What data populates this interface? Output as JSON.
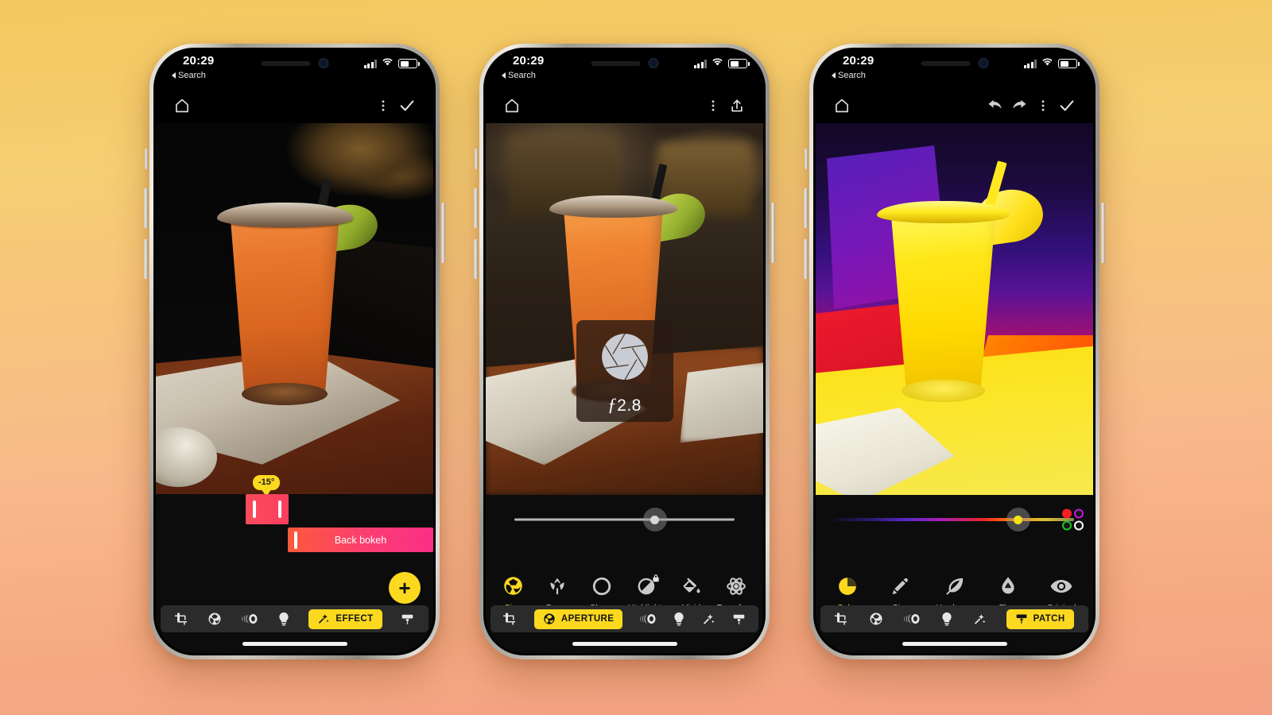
{
  "background": {
    "top_color": "#f3c85f",
    "bottom_color": "#f3a184"
  },
  "accent": {
    "yellow": "#fcd91f",
    "red_slider": "#fb4a5c",
    "pink_slider": "#fa2f86"
  },
  "status_bar": {
    "time": "20:29",
    "back_label": "Search"
  },
  "phones": [
    {
      "id": "phone-one",
      "appbar": {
        "home_icon": "home-icon",
        "menu_icon": "overflow-menu-icon",
        "confirm_icon": "checkmark-icon"
      },
      "overlay": {
        "angle_tooltip": "-15°",
        "effect_slider_label": "Back bokeh"
      },
      "fab_label": "+",
      "bottom_nav": {
        "items": [
          {
            "name": "crop",
            "icon": "crop-icon",
            "label": ""
          },
          {
            "name": "aperture",
            "icon": "aperture-icon",
            "label": ""
          },
          {
            "name": "lens",
            "icon": "lens-icon",
            "label": ""
          },
          {
            "name": "light",
            "icon": "bulb-icon",
            "label": ""
          },
          {
            "name": "effect",
            "icon": "magic-wand-icon",
            "label": "EFFECT",
            "active": true
          },
          {
            "name": "patch",
            "icon": "brush-icon",
            "label": ""
          }
        ]
      }
    },
    {
      "id": "phone-two",
      "appbar": {
        "home_icon": "home-icon",
        "menu_icon": "overflow-menu-icon",
        "share_icon": "share-icon"
      },
      "overlay": {
        "aperture_value": "2.8",
        "aperture_prefix": "ƒ",
        "icon": "aperture-blades-icon"
      },
      "slider": {
        "value_pct": 61
      },
      "tools": [
        {
          "label": "Size",
          "icon": "aperture-icon",
          "active": true,
          "fill_pct": 45
        },
        {
          "label": "Focus",
          "icon": "tulip-icon",
          "active": false,
          "fill_pct": 32
        },
        {
          "label": "Shape",
          "icon": "circle-icon",
          "active": false,
          "fill_pct": 30
        },
        {
          "label": "Highlights",
          "icon": "contrast-lock-icon",
          "active": false,
          "fill_pct": 24
        },
        {
          "label": "Vivid",
          "icon": "paint-bucket-icon",
          "active": false,
          "fill_pct": 28
        },
        {
          "label": "Transform",
          "icon": "atom-icon",
          "active": false,
          "fill_pct": 30
        }
      ],
      "bottom_nav": {
        "items": [
          {
            "name": "crop",
            "icon": "crop-icon",
            "label": ""
          },
          {
            "name": "aperture",
            "icon": "aperture-icon",
            "label": "APERTURE",
            "active": true
          },
          {
            "name": "lens",
            "icon": "lens-icon",
            "label": ""
          },
          {
            "name": "light",
            "icon": "bulb-icon",
            "label": ""
          },
          {
            "name": "effect",
            "icon": "magic-wand-icon",
            "label": ""
          },
          {
            "name": "patch",
            "icon": "brush-icon",
            "label": ""
          }
        ]
      }
    },
    {
      "id": "phone-three",
      "appbar": {
        "home_icon": "home-icon",
        "undo_icon": "undo-icon",
        "redo_icon": "redo-icon",
        "menu_icon": "overflow-menu-icon",
        "confirm_icon": "checkmark-icon"
      },
      "slider": {
        "type": "hue",
        "value_pct": 73
      },
      "swatches": [
        {
          "name": "swatch-red",
          "color": "#f61f22",
          "selected": true
        },
        {
          "name": "swatch-magenta",
          "color": "#c41ae0",
          "selected": false
        },
        {
          "name": "swatch-green",
          "color": "#16c924",
          "selected": false
        },
        {
          "name": "swatch-white",
          "color": "#ffffff",
          "selected": false
        }
      ],
      "tools": [
        {
          "label": "Color",
          "icon": "color-wheel-icon",
          "active": true,
          "fill_pct": 0
        },
        {
          "label": "Size",
          "icon": "paintbrush-icon",
          "active": false,
          "fill_pct": 22
        },
        {
          "label": "Hardness",
          "icon": "feather-icon",
          "active": false,
          "fill_pct": 96
        },
        {
          "label": "Flow",
          "icon": "droplet-icon",
          "active": false,
          "fill_pct": 92
        },
        {
          "label": "Original",
          "icon": "eye-icon",
          "active": false,
          "fill_pct": 92
        }
      ],
      "bottom_nav": {
        "items": [
          {
            "name": "crop",
            "icon": "crop-icon",
            "label": ""
          },
          {
            "name": "aperture",
            "icon": "aperture-icon",
            "label": ""
          },
          {
            "name": "lens",
            "icon": "lens-icon",
            "label": ""
          },
          {
            "name": "light",
            "icon": "bulb-icon",
            "label": ""
          },
          {
            "name": "effect",
            "icon": "magic-wand-icon",
            "label": ""
          },
          {
            "name": "patch",
            "icon": "brush-icon",
            "label": "PATCH",
            "active": true
          }
        ]
      }
    }
  ]
}
